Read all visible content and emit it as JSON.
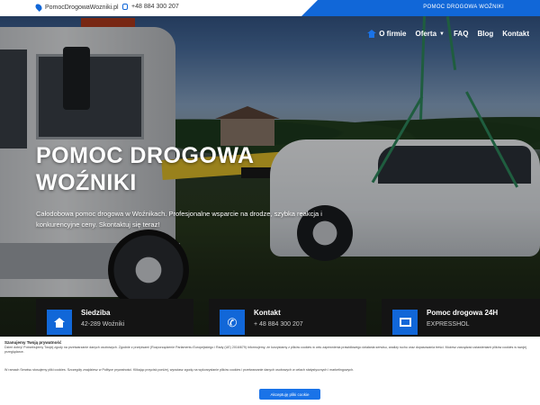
{
  "topbar": {
    "email": "PomocDrogowaWozniki.pl",
    "phone": "+48 884 300 207",
    "tagline": "POMOC DROGOWA WOŹNIKI"
  },
  "nav": {
    "items": [
      {
        "label": "O firmie",
        "icon": "home-icon",
        "has_caret": false
      },
      {
        "label": "Oferta",
        "has_caret": true
      },
      {
        "label": "FAQ",
        "has_caret": false
      },
      {
        "label": "Blog",
        "has_caret": false
      },
      {
        "label": "Kontakt",
        "has_caret": false
      }
    ]
  },
  "hero": {
    "title_line1": "POMOC DROGOWA",
    "title_line2": "WOŹNIKI",
    "subtitle": "Całodobowa pomoc drogowa w Woźnikach. Profesjonalne wsparcie na drodze, szybka reakcja i konkurencyjne ceny. Skontaktuj się teraz!"
  },
  "cards": [
    {
      "icon": "home-icon",
      "title": "Siedziba",
      "text": "42-289 Woźniki"
    },
    {
      "icon": "phone-icon",
      "title": "Kontakt",
      "text": "+ 48 884 300 207"
    },
    {
      "icon": "mail-icon",
      "title": "Pomoc drogowa 24H",
      "text": "EXPRESSHOL"
    }
  ],
  "cookie": {
    "title": "Szanujemy Twoją prywatność",
    "text": "Dzień dobry! Potrzebujemy Twojej zgody na przetwarzanie danych osobowych. Zgodnie z przepisami (Rozporządzenie Parlamentu Europejskiego i Rady (UE) 2016/679) informujemy, że korzystamy z plików cookies w celu zapewnienia prawidłowego działania serwisu, analizy ruchu oraz dopasowania treści. Możesz zarządzać ustawieniami plików cookies w swojej przeglądarce.",
    "text2": "W ramach Serwisu stosujemy pliki cookies. Szczegóły znajdziesz w Polityce prywatności. Klikając przycisk poniżej, wyrażasz zgodę na wykorzystanie plików cookies i przetwarzanie danych osobowych w celach statystycznych i marketingowych.",
    "button": "Akceptuję pliki cookie"
  },
  "colors": {
    "accent": "#1167d8",
    "card_bg": "#141414",
    "boom_yellow": "#e2bf2a"
  }
}
